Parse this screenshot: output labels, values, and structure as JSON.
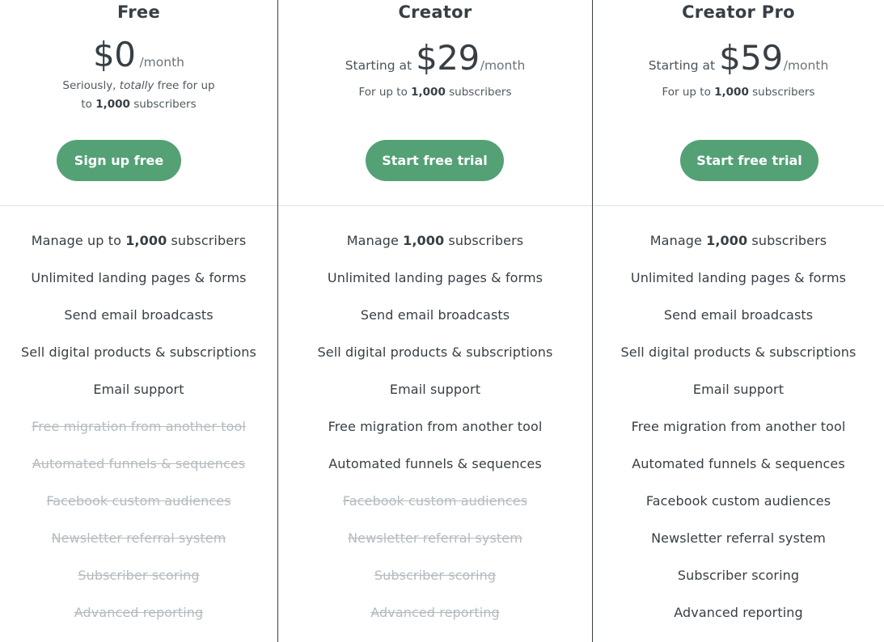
{
  "brand": {
    "accent": "#55a176",
    "divider": "#dfe3e6",
    "text": "#373f45",
    "muted": "#b4bbc0"
  },
  "plans": [
    {
      "name": "Free",
      "starting_prefix": "",
      "amount": "$0",
      "period": "/month",
      "subtitle_pre": "Seriously, ",
      "subtitle_em": "totally",
      "subtitle_mid": " free for up to ",
      "subtitle_bold": "1,000",
      "subtitle_post": " subscribers",
      "cta_label": "Sign up free",
      "features": [
        {
          "pre": "Manage up to ",
          "bold": "1,000",
          "post": " subscribers",
          "included": true
        },
        {
          "pre": "Unlimited landing pages & forms",
          "bold": "",
          "post": "",
          "included": true
        },
        {
          "pre": "Send email broadcasts",
          "bold": "",
          "post": "",
          "included": true
        },
        {
          "pre": "Sell digital products & subscriptions",
          "bold": "",
          "post": "",
          "included": true
        },
        {
          "pre": "Email support",
          "bold": "",
          "post": "",
          "included": true
        },
        {
          "pre": "Free migration from another tool",
          "bold": "",
          "post": "",
          "included": false
        },
        {
          "pre": "Automated funnels & sequences",
          "bold": "",
          "post": "",
          "included": false
        },
        {
          "pre": "Facebook custom audiences",
          "bold": "",
          "post": "",
          "included": false
        },
        {
          "pre": "Newsletter referral system",
          "bold": "",
          "post": "",
          "included": false
        },
        {
          "pre": "Subscriber scoring",
          "bold": "",
          "post": "",
          "included": false
        },
        {
          "pre": "Advanced reporting",
          "bold": "",
          "post": "",
          "included": false
        }
      ]
    },
    {
      "name": "Creator",
      "starting_prefix": "Starting at",
      "amount": "$29",
      "period": "/month",
      "subtitle_pre": "For up to ",
      "subtitle_em": "",
      "subtitle_mid": "",
      "subtitle_bold": "1,000",
      "subtitle_post": " subscribers",
      "cta_label": "Start free trial",
      "features": [
        {
          "pre": "Manage ",
          "bold": "1,000",
          "post": " subscribers",
          "included": true
        },
        {
          "pre": "Unlimited landing pages & forms",
          "bold": "",
          "post": "",
          "included": true
        },
        {
          "pre": "Send email broadcasts",
          "bold": "",
          "post": "",
          "included": true
        },
        {
          "pre": "Sell digital products & subscriptions",
          "bold": "",
          "post": "",
          "included": true
        },
        {
          "pre": "Email support",
          "bold": "",
          "post": "",
          "included": true
        },
        {
          "pre": "Free migration from another tool",
          "bold": "",
          "post": "",
          "included": true
        },
        {
          "pre": "Automated funnels & sequences",
          "bold": "",
          "post": "",
          "included": true
        },
        {
          "pre": "Facebook custom audiences",
          "bold": "",
          "post": "",
          "included": false
        },
        {
          "pre": "Newsletter referral system",
          "bold": "",
          "post": "",
          "included": false
        },
        {
          "pre": "Subscriber scoring",
          "bold": "",
          "post": "",
          "included": false
        },
        {
          "pre": "Advanced reporting",
          "bold": "",
          "post": "",
          "included": false
        }
      ]
    },
    {
      "name": "Creator Pro",
      "starting_prefix": "Starting at",
      "amount": "$59",
      "period": "/month",
      "subtitle_pre": "For up to ",
      "subtitle_em": "",
      "subtitle_mid": "",
      "subtitle_bold": "1,000",
      "subtitle_post": " subscribers",
      "cta_label": "Start free trial",
      "features": [
        {
          "pre": "Manage ",
          "bold": "1,000",
          "post": " subscribers",
          "included": true
        },
        {
          "pre": "Unlimited landing pages & forms",
          "bold": "",
          "post": "",
          "included": true
        },
        {
          "pre": "Send email broadcasts",
          "bold": "",
          "post": "",
          "included": true
        },
        {
          "pre": "Sell digital products & subscriptions",
          "bold": "",
          "post": "",
          "included": true
        },
        {
          "pre": "Email support",
          "bold": "",
          "post": "",
          "included": true
        },
        {
          "pre": "Free migration from another tool",
          "bold": "",
          "post": "",
          "included": true
        },
        {
          "pre": "Automated funnels & sequences",
          "bold": "",
          "post": "",
          "included": true
        },
        {
          "pre": "Facebook custom audiences",
          "bold": "",
          "post": "",
          "included": true
        },
        {
          "pre": "Newsletter referral system",
          "bold": "",
          "post": "",
          "included": true
        },
        {
          "pre": "Subscriber scoring",
          "bold": "",
          "post": "",
          "included": true
        },
        {
          "pre": "Advanced reporting",
          "bold": "",
          "post": "",
          "included": true
        }
      ]
    }
  ]
}
